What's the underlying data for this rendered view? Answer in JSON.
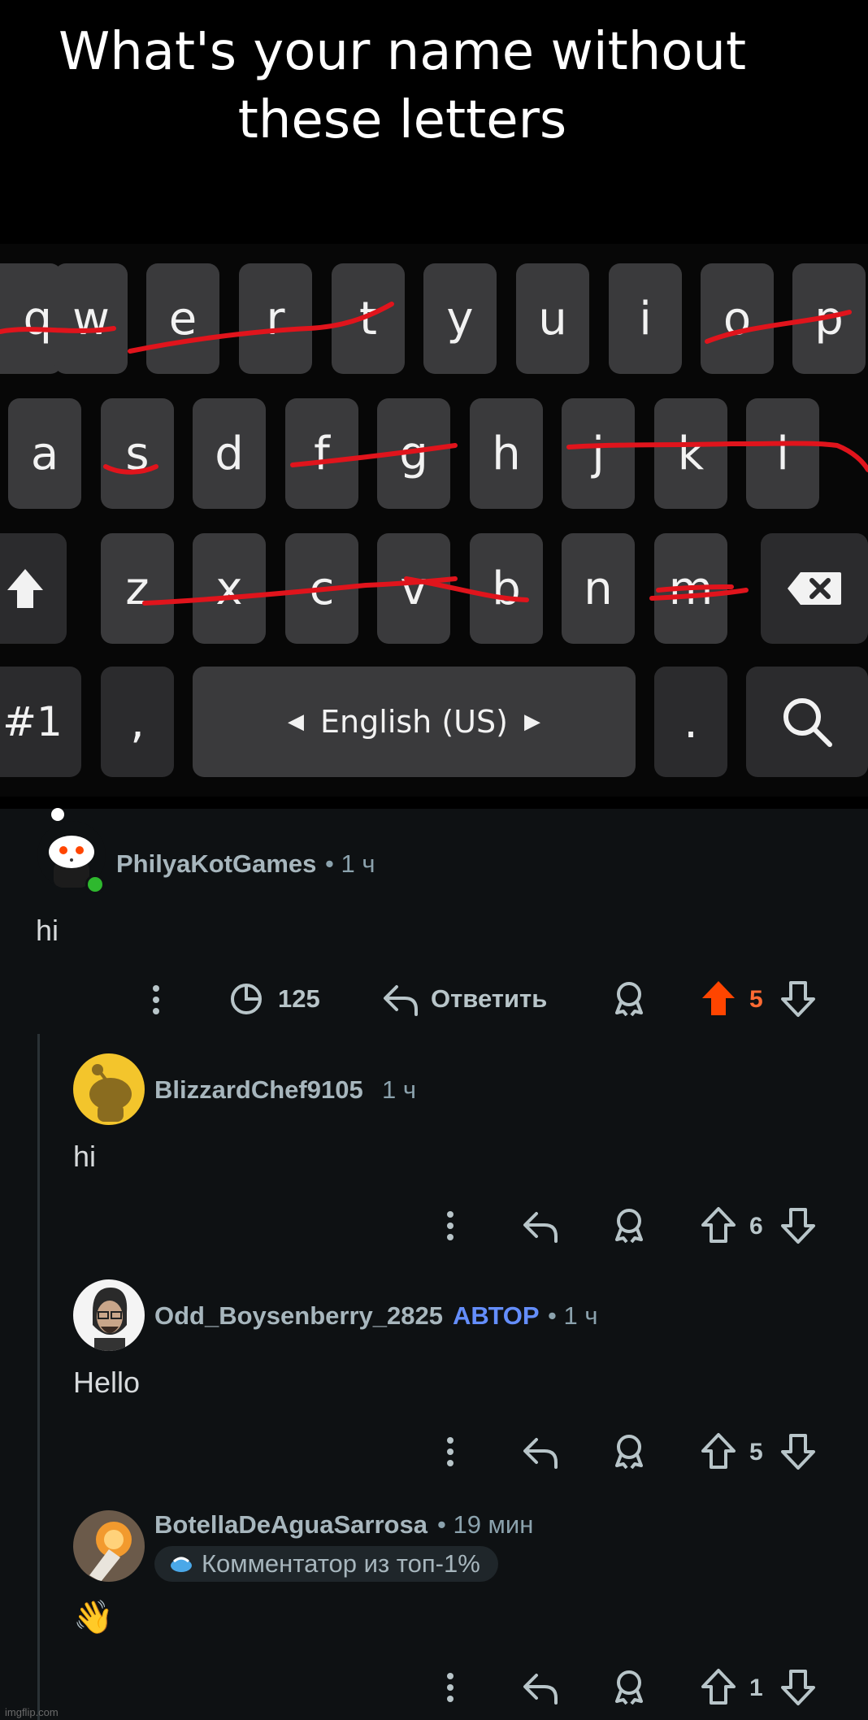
{
  "meme": {
    "caption_line1": "What's your name without",
    "caption_line2": "these letters"
  },
  "keyboard": {
    "row1": [
      "q",
      "w",
      "e",
      "r",
      "t",
      "y",
      "u",
      "i",
      "o",
      "p"
    ],
    "row2": [
      "a",
      "s",
      "d",
      "f",
      "g",
      "h",
      "j",
      "k",
      "l"
    ],
    "row3": [
      "z",
      "x",
      "c",
      "v",
      "b",
      "n",
      "m"
    ],
    "symbols_key": "#1",
    "comma_key": ",",
    "space_label": "English (US)",
    "period_key": ".",
    "crossed_out": [
      "q",
      "w",
      "e",
      "r",
      "t",
      "o",
      "s",
      "f",
      "g",
      "j",
      "k",
      "l",
      "z",
      "x",
      "c",
      "v",
      "b",
      "m"
    ],
    "strike_color": "#e0141c"
  },
  "comments": [
    {
      "username": "PhilyaKotGames",
      "time": "• 1 ч",
      "body": "hi",
      "view_count": "125",
      "reply_label": "Ответить",
      "score": "5",
      "upvoted": true
    },
    {
      "username": "BlizzardChef9105",
      "time": "1 ч",
      "body": "hi",
      "score": "6"
    },
    {
      "username": "Odd_Boysenberry_2825",
      "author_badge": "АВТОР",
      "time": "• 1 ч",
      "body": "Hello",
      "score": "5"
    },
    {
      "username": "BotellaDeAguaSarrosa",
      "time": "• 19 мин",
      "flair": "Комментатор из топ-1%",
      "body": "👋",
      "score": "1"
    }
  ],
  "watermark": "imgflip.com",
  "colors": {
    "background": "#0e1113",
    "upvote_accent": "#ff4500",
    "author_badge": "#648efc",
    "online_dot": "#2eb82e"
  }
}
